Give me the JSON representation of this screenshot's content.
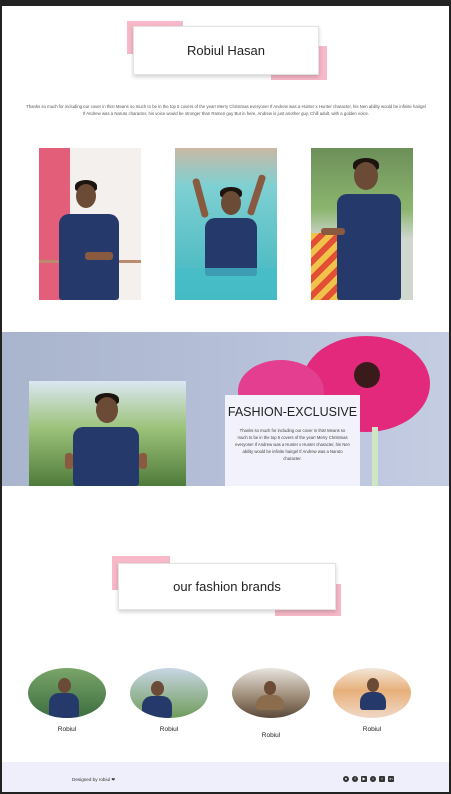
{
  "header": {
    "title": "Robiul Hasan"
  },
  "intro": {
    "text": "Thanks so much for including our cover in this! Means so much to be in the top 5 covers of the year! Merry Christmas everyone! If Andrew was a Hunter x Hunter character, his Nen ability would be infinite hairgel If Andrew was a Naruto character, his voice would be stronger than Ramen guy But in here, Andrew is just another guy, Chill adult, with a golden voice."
  },
  "feature": {
    "title": "FASHION-EXCLUSIVE",
    "text": "Thanks so much for including our cover in this! Means so much to be in the top 5 covers of the year! Merry Christmas everyone! If Andrew was a Hunter x Hunter character, his Nen ability would be infinite hairgel If Andrew was a Naruto character."
  },
  "brands": {
    "title": "our fashion brands",
    "items": [
      {
        "name": "Robiul"
      },
      {
        "name": "Robiul"
      },
      {
        "name": "Robiul"
      },
      {
        "name": "Robiul"
      }
    ]
  },
  "footer": {
    "credit": "Designed by robiul ❤",
    "social_icons": [
      "github-icon",
      "facebook-icon",
      "youtube-icon",
      "instagram-icon",
      "twitter-icon",
      "linkedin-icon"
    ]
  },
  "colors": {
    "accent_pink": "#f7b8c7",
    "band": "#b6c0d8",
    "footer_bg": "#eeeffa",
    "flower": "#e2297c"
  }
}
